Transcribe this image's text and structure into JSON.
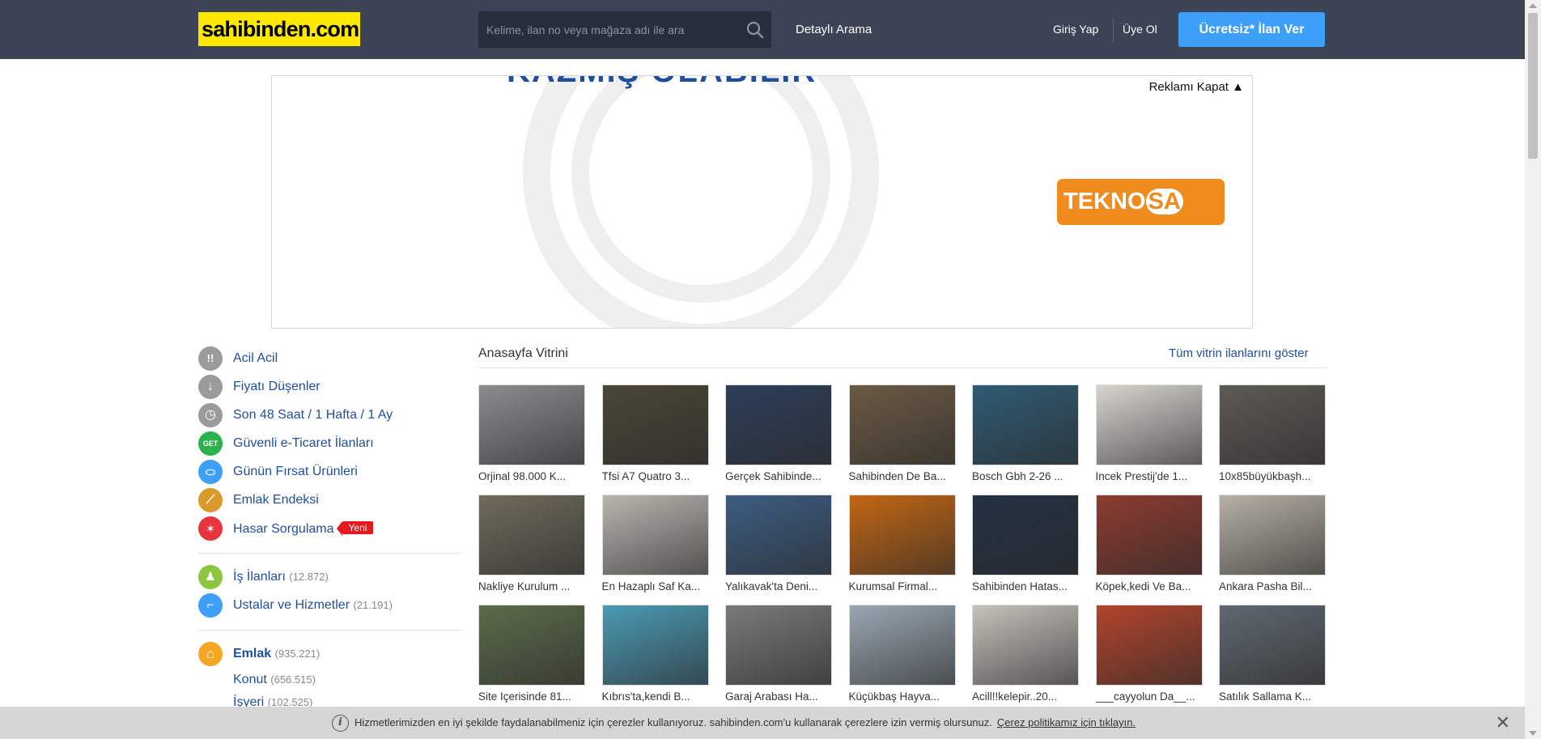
{
  "header": {
    "logo": "sahibinden.com",
    "search_placeholder": "Kelime, ilan no veya mağaza adı ile ara",
    "detailed_search": "Detaylı Arama",
    "login": "Giriş Yap",
    "register": "Üye Ol",
    "post_ad": "Ücretsiz* İlan Ver"
  },
  "ad": {
    "close_label": "Reklamı Kapat ▲",
    "headline": "KAZMIŞ OLABİLİR",
    "brand": "TEKNOSA",
    "brand_part1": "TEKNO",
    "brand_part2": "SA"
  },
  "sidebar": {
    "quick_links": [
      {
        "label": "Acil Acil",
        "icon": "exclamation-icon",
        "icon_glyph": "!!",
        "color": "#9b9b9b"
      },
      {
        "label": "Fiyatı Düşenler",
        "icon": "arrow-down-icon",
        "icon_glyph": "↓",
        "color": "#9b9b9b"
      },
      {
        "label": "Son 48 Saat / 1 Hafta / 1 Ay",
        "icon": "clock-icon",
        "icon_glyph": "◷",
        "color": "#9b9b9b"
      },
      {
        "label": "Güvenli e-Ticaret İlanları",
        "icon": "get-icon",
        "icon_glyph": "GET",
        "color": "#2bb24c"
      },
      {
        "label": "Günün Fırsat Ürünleri",
        "icon": "tag-icon",
        "icon_glyph": "⬭",
        "color": "#3d9ff7"
      },
      {
        "label": "Emlak Endeksi",
        "icon": "chart-icon",
        "icon_glyph": "⟋",
        "color": "#e6a01e"
      },
      {
        "label": "Hasar Sorgulama",
        "icon": "car-crash-icon",
        "icon_glyph": "✶",
        "color": "#e8343d",
        "badge": "Yeni"
      }
    ],
    "categories": [
      {
        "label": "İş İlanları",
        "count": "(12.872)",
        "icon": "worker-icon",
        "icon_glyph": "♟",
        "color": "#8cc63f"
      },
      {
        "label": "Ustalar ve Hizmetler",
        "count": "(21.191)",
        "icon": "paint-roller-icon",
        "icon_glyph": "⌐",
        "color": "#3d9ff7"
      },
      {
        "label": "Emlak",
        "count": "(935.221)",
        "icon": "home-icon",
        "icon_glyph": "⌂",
        "color": "#f5a623"
      }
    ],
    "sub_items": [
      {
        "label": "Konut",
        "count": "(656.515)"
      },
      {
        "label": "İşyeri",
        "count": "(102.525)"
      }
    ]
  },
  "vitrin": {
    "title": "Anasayfa Vitrini",
    "show_all": "Tüm vitrin ilanlarını göster",
    "items": [
      {
        "title": "Orjinal 98.000 K...",
        "bg": "#8a8d8f"
      },
      {
        "title": "Tfsi A7 Quatro 3...",
        "bg": "#4a4636"
      },
      {
        "title": "Gerçek Sahibinde...",
        "bg": "#2d3e59"
      },
      {
        "title": "Sahibinden De Ba...",
        "bg": "#6b5a44"
      },
      {
        "title": "Bosch Gbh 2-26 ...",
        "bg": "#2f5b73"
      },
      {
        "title": "Incek Prestij'de 1...",
        "bg": "#d9d4cf"
      },
      {
        "title": "10x85büyükbaşh...",
        "bg": "#5e5a54"
      },
      {
        "title": "Nakliye Kurulum ...",
        "bg": "#6f6a5c"
      },
      {
        "title": "En Hazaplı Saf Ka...",
        "bg": "#b8b6b0"
      },
      {
        "title": "Yalıkavak'ta Deni...",
        "bg": "#3c5d82"
      },
      {
        "title": "Kurumsal Firmal...",
        "bg": "#c26614"
      },
      {
        "title": "Sahibinden Hatas...",
        "bg": "#223043"
      },
      {
        "title": "Köpek,kedi Ve Ba...",
        "bg": "#8d3b2f"
      },
      {
        "title": "Ankara Pasha Bil...",
        "bg": "#b7b1a6"
      },
      {
        "title": "Site Içerisinde 81...",
        "bg": "#5c6b4a"
      },
      {
        "title": "Kıbrıs'ta,kendi B...",
        "bg": "#4b9ab4"
      },
      {
        "title": "Garaj Arabası Ha...",
        "bg": "#7a7a78"
      },
      {
        "title": "Küçükbaş Hayva...",
        "bg": "#9aa7b2"
      },
      {
        "title": "Acill!!kelepir..20...",
        "bg": "#c5c2bb"
      },
      {
        "title": "___cayyolun Da__...",
        "bg": "#b2442c"
      },
      {
        "title": "Satılık Sallama K...",
        "bg": "#5f6870"
      }
    ]
  },
  "cookie": {
    "text": "Hizmetlerimizden en iyi şekilde faydalanabilmeniz için çerezler kullanıyoruz. sahibinden.com'u kullanarak çerezlere izin vermiş olursunuz.",
    "link": "Çerez politikamız için tıklayın.",
    "close": "✕"
  }
}
